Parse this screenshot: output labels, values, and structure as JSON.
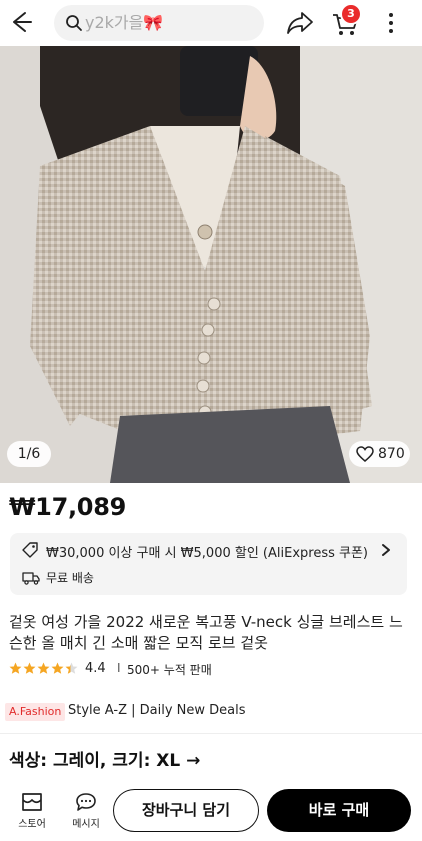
{
  "header": {
    "search_placeholder": "y2k가을🎀",
    "cart_count": "3"
  },
  "gallery": {
    "counter": "1/6",
    "likes": "870"
  },
  "product": {
    "price": "₩17,089",
    "coupon_text": "₩30,000 이상 구매 시 ₩5,000 할인 (AliExpress 쿠폰)",
    "shipping_text": "무료 배송",
    "title": "겉옷 여성 가을 2022 새로운 복고풍 V-neck 싱글 브레스트 느슨한 올 매치 긴 소매 짧은 모직 로브 겉옷",
    "rating": "4.4",
    "rating_stars": 4.4,
    "sold": "500+ 누적 판매",
    "rating_separator": "I"
  },
  "store": {
    "logo_text": "A.Fashion",
    "tagline": "Style A-Z | Daily New Deals"
  },
  "option": {
    "label": "색상: 그레이, 크기: XL →"
  },
  "bottom": {
    "store_label": "스토어",
    "message_label": "메시지",
    "add_to_cart": "장바구니 담기",
    "buy_now": "바로 구매"
  },
  "colors": {
    "accent_red": "#ea2b2b",
    "star_orange": "#f5a623",
    "buy_button": "#000000"
  }
}
